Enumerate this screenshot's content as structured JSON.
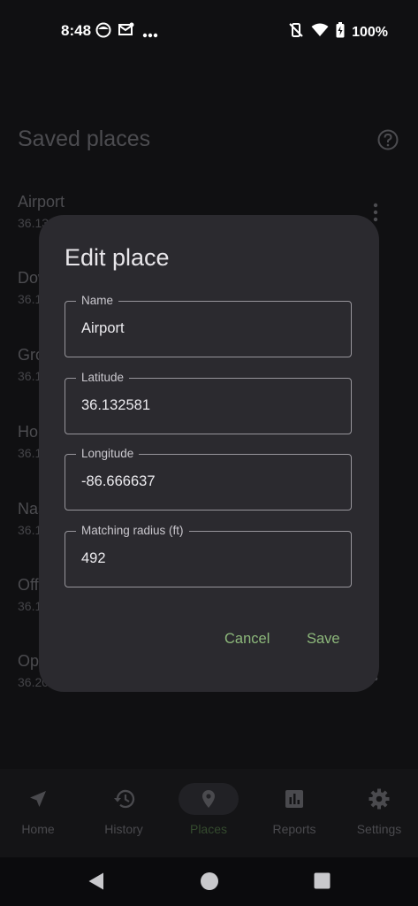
{
  "status_bar": {
    "time": "8:48",
    "battery": "100%"
  },
  "page": {
    "title": "Saved places",
    "places": [
      {
        "name": "Airport",
        "coord": "36.132581, -86.666637"
      },
      {
        "name": "Downtown",
        "coord": "36.162664, -86.781602"
      },
      {
        "name": "Grocery",
        "coord": "36.151400, -86.796700"
      },
      {
        "name": "Home",
        "coord": "36.106500, -86.816400"
      },
      {
        "name": "Nashville",
        "coord": "36.174500, -86.767800"
      },
      {
        "name": "Office",
        "coord": "36.153000, -86.783500"
      },
      {
        "name": "Opry",
        "coord": "36.206900, -86.692400"
      }
    ]
  },
  "dialog": {
    "title": "Edit place",
    "fields": {
      "name": {
        "label": "Name",
        "value": "Airport"
      },
      "latitude": {
        "label": "Latitude",
        "value": "36.132581"
      },
      "longitude": {
        "label": "Longitude",
        "value": "-86.666637"
      },
      "radius": {
        "label": "Matching radius (ft)",
        "value": "492"
      }
    },
    "cancel_label": "Cancel",
    "save_label": "Save"
  },
  "bottom_nav": {
    "items": [
      {
        "label": "Home",
        "icon": "navigation-arrow-icon"
      },
      {
        "label": "History",
        "icon": "history-icon"
      },
      {
        "label": "Places",
        "icon": "place-pin-icon",
        "active": true
      },
      {
        "label": "Reports",
        "icon": "bar-chart-icon"
      },
      {
        "label": "Settings",
        "icon": "gear-icon"
      }
    ]
  },
  "colors": {
    "accent": "#8db87b",
    "dialog_bg": "#2b2a2f"
  }
}
